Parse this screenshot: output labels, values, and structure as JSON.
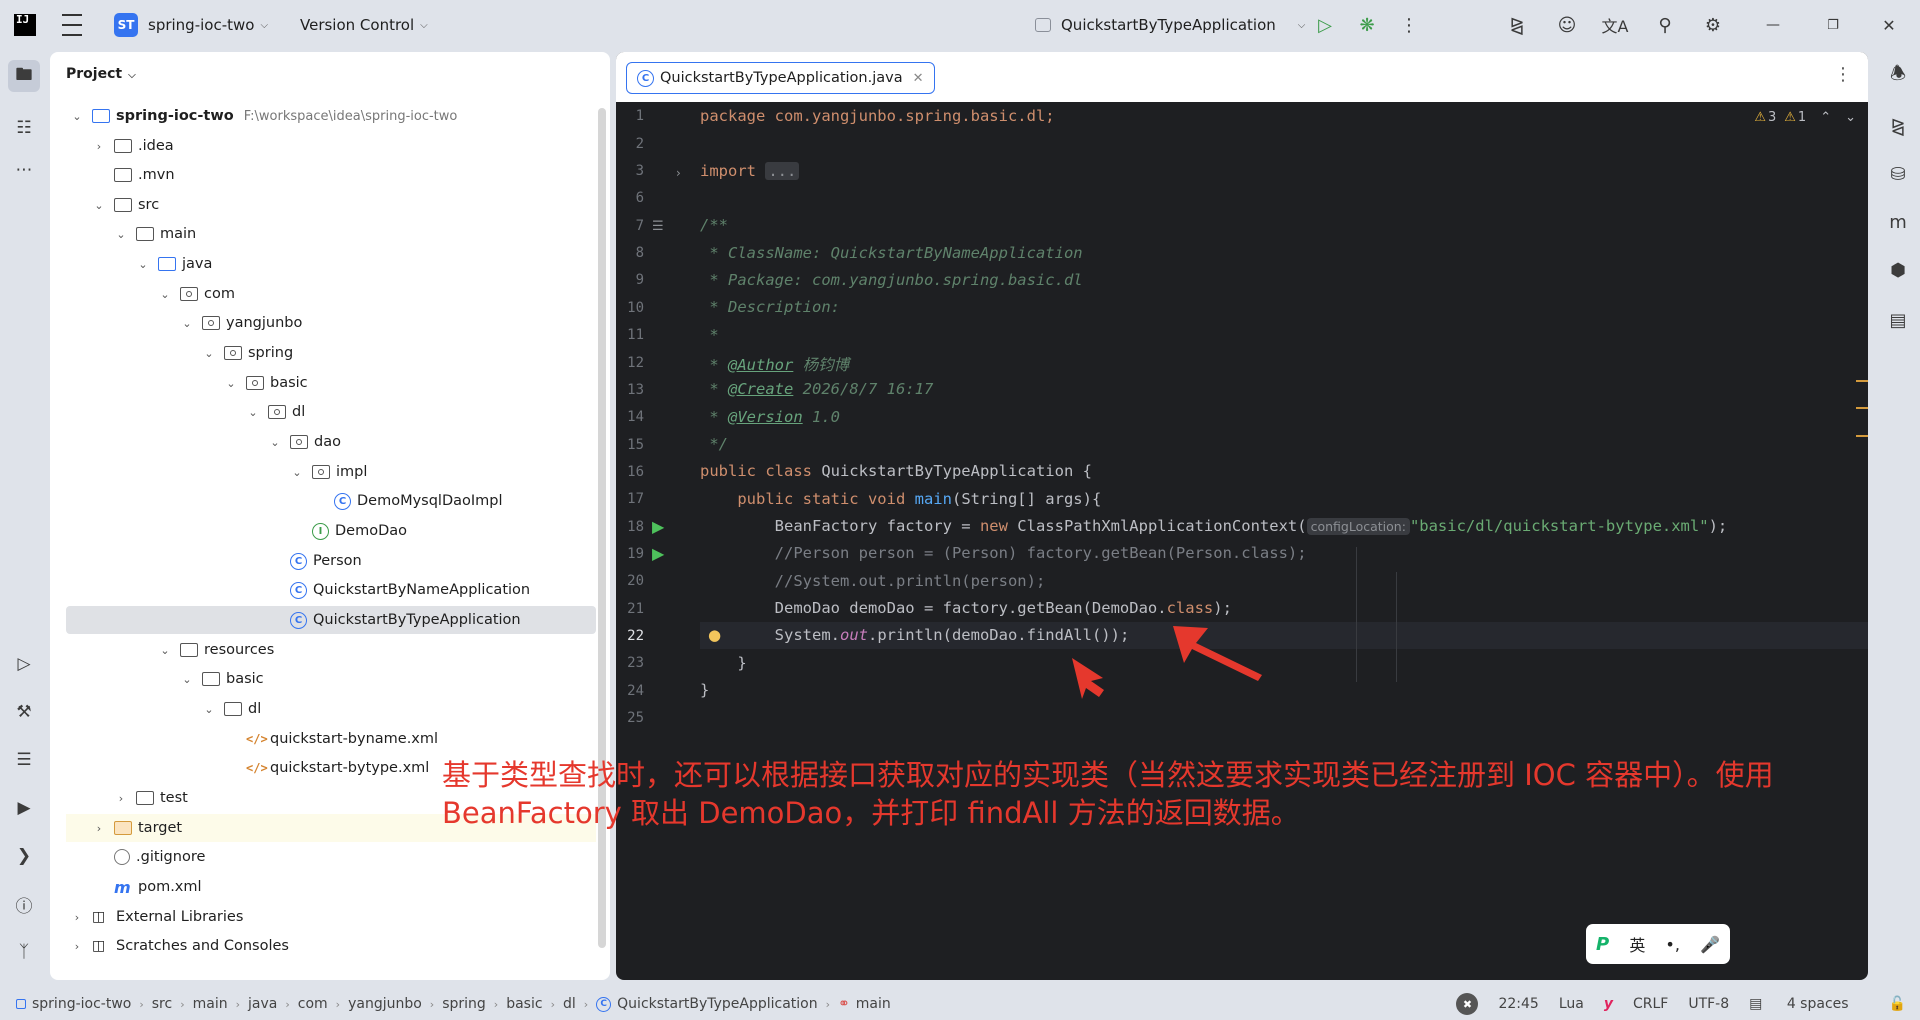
{
  "titlebar": {
    "app_icon_text": "IJ",
    "project_badge": "ST",
    "project_name": "spring-ioc-two",
    "vcs": "Version Control",
    "run_config": "QuickstartByTypeApplication",
    "icons": [
      "hamburger-menu-icon",
      "run-icon",
      "debug-icon",
      "more-icon",
      "ai-assistant-icon",
      "add-user-icon",
      "translate-icon",
      "search-icon",
      "settings-icon",
      "minimize-icon",
      "restore-icon",
      "close-icon"
    ]
  },
  "left_strip": [
    "folder-icon",
    "structure-icon",
    "more-icon",
    "run-icon",
    "build-icon",
    "services-icon",
    "debug-icon",
    "terminal-icon",
    "problems-icon",
    "git-icon"
  ],
  "right_strip": [
    "notifications-icon",
    "ai-chat-icon",
    "database-icon",
    "maven-icon",
    "plugin-icon",
    "bookmark-icon"
  ],
  "project_panel": {
    "title": "Project",
    "root_name": "spring-ioc-two",
    "root_path": "F:\\workspace\\idea\\spring-ioc-two",
    "items": [
      {
        "label": ".idea"
      },
      {
        "label": ".mvn"
      },
      {
        "label": "src"
      },
      {
        "label": "main"
      },
      {
        "label": "java"
      },
      {
        "label": "com"
      },
      {
        "label": "yangjunbo"
      },
      {
        "label": "spring"
      },
      {
        "label": "basic"
      },
      {
        "label": "dl"
      },
      {
        "label": "dao"
      },
      {
        "label": "impl"
      },
      {
        "label": "DemoMysqlDaoImpl"
      },
      {
        "label": "DemoDao"
      },
      {
        "label": "Person"
      },
      {
        "label": "QuickstartByNameApplication"
      },
      {
        "label": "QuickstartByTypeApplication"
      },
      {
        "label": "resources"
      },
      {
        "label": "basic"
      },
      {
        "label": "dl"
      },
      {
        "label": "quickstart-byname.xml"
      },
      {
        "label": "quickstart-bytype.xml"
      },
      {
        "label": "test"
      },
      {
        "label": "target"
      },
      {
        "label": ".gitignore"
      },
      {
        "label": "pom.xml"
      },
      {
        "label": "External Libraries"
      },
      {
        "label": "Scratches and Consoles"
      }
    ]
  },
  "editor": {
    "tab_label": "QuickstartByTypeApplication.java",
    "inspection": {
      "warnings": "3",
      "weak_warnings": "1"
    },
    "line_numbers": [
      "1",
      "2",
      "3",
      "6",
      "7",
      "8",
      "9",
      "10",
      "11",
      "12",
      "13",
      "14",
      "15",
      "16",
      "17",
      "18",
      "19",
      "20",
      "21",
      "22",
      "23",
      "24",
      "25"
    ],
    "lines": {
      "l1": "package com.yangjunbo.spring.basic.dl;",
      "l3_kw": "import",
      "l3_fold": "...",
      "l7": "/**",
      "l8": " * ClassName: QuickstartByNameApplication",
      "l9": " * Package: com.yangjunbo.spring.basic.dl",
      "l10": " * Description:",
      "l11": " *",
      "l12_pre": " * ",
      "l12_tag": "@Author",
      "l12_val": " 杨钧博",
      "l13_pre": " * ",
      "l13_tag": "@Create",
      "l13_val": " 2026/8/7 16:17",
      "l14_pre": " * ",
      "l14_tag": "@Version",
      "l14_val": " 1.0",
      "l15": " */",
      "l16_kw": "public class",
      "l16_rest": " QuickstartByTypeApplication {",
      "l17_kw": "    public static void",
      "l17_fn": " main",
      "l17_rest": "(String[] args){",
      "l18_a": "        BeanFactory factory = ",
      "l18_kw": "new",
      "l18_b": " ClassPathXmlApplicationContext(",
      "l18_hint": "configLocation:",
      "l18_str": "\"basic/dl/quickstart-bytype.xml\"",
      "l18_end": ");",
      "l19": "        //Person person = (Person) factory.getBean(Person.class);",
      "l20": "        //System.out.println(person);",
      "l21_a": "        DemoDao demoDao = factory.getBean(DemoDao.",
      "l21_kw": "class",
      "l21_b": ");",
      "l22_a": "        System.",
      "l22_field": "out",
      "l22_b": ".println(demoDao.findAll());",
      "l23": "    }",
      "l24": "}"
    }
  },
  "annotation": {
    "line1": "基于类型查找时，还可以根据接口获取对应的实现类（当然这要求实现类已经注册到 IOC 容器中）。使用",
    "line2": "BeanFactory 取出 DemoDao，并打印 findAll 方法的返回数据。"
  },
  "ime": {
    "lang": "英",
    "punct": "•,"
  },
  "statusbar": {
    "breadcrumbs": [
      "spring-ioc-two",
      "src",
      "main",
      "java",
      "com",
      "yangjunbo",
      "spring",
      "basic",
      "dl",
      "QuickstartByTypeApplication",
      "main"
    ],
    "time": "22:45",
    "lang": "Lua",
    "line_sep": "CRLF",
    "encoding": "UTF-8",
    "indent": "4 spaces"
  },
  "colors": {
    "accent": "#3574f0",
    "annotation": "#e5382d",
    "editor_bg": "#1e1f22"
  }
}
